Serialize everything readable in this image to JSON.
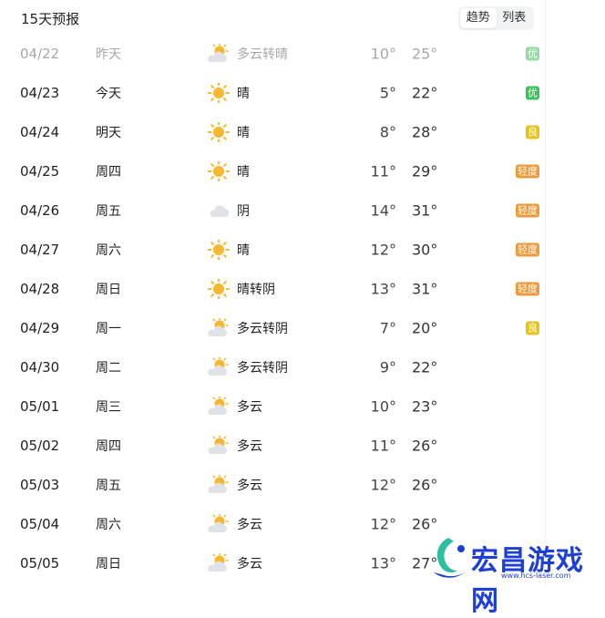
{
  "header": {
    "title": "15天预报"
  },
  "toggle": {
    "trend_label": "趋势",
    "list_label": "列表"
  },
  "days": [
    {
      "date": "04/22",
      "day": "昨天",
      "icon": "partly-cloudy-icon",
      "cond": "多云转晴",
      "low": "10°",
      "high": "25°",
      "aqi": "优",
      "aqi_level": "you",
      "past": true
    },
    {
      "date": "04/23",
      "day": "今天",
      "icon": "sun-icon",
      "cond": "晴",
      "low": "5°",
      "high": "22°",
      "aqi": "优",
      "aqi_level": "you"
    },
    {
      "date": "04/24",
      "day": "明天",
      "icon": "sun-icon",
      "cond": "晴",
      "low": "8°",
      "high": "28°",
      "aqi": "良",
      "aqi_level": "liang"
    },
    {
      "date": "04/25",
      "day": "周四",
      "icon": "sun-icon",
      "cond": "晴",
      "low": "11°",
      "high": "29°",
      "aqi": "轻度",
      "aqi_level": "qingdu"
    },
    {
      "date": "04/26",
      "day": "周五",
      "icon": "cloud-icon",
      "cond": "阴",
      "low": "14°",
      "high": "31°",
      "aqi": "轻度",
      "aqi_level": "qingdu"
    },
    {
      "date": "04/27",
      "day": "周六",
      "icon": "sun-icon",
      "cond": "晴",
      "low": "12°",
      "high": "30°",
      "aqi": "轻度",
      "aqi_level": "qingdu"
    },
    {
      "date": "04/28",
      "day": "周日",
      "icon": "sun-icon",
      "cond": "晴转阴",
      "low": "13°",
      "high": "31°",
      "aqi": "轻度",
      "aqi_level": "qingdu"
    },
    {
      "date": "04/29",
      "day": "周一",
      "icon": "partly-cloudy-icon",
      "cond": "多云转阴",
      "low": "7°",
      "high": "20°",
      "aqi": "良",
      "aqi_level": "liang"
    },
    {
      "date": "04/30",
      "day": "周二",
      "icon": "partly-cloudy-icon",
      "cond": "多云转阴",
      "low": "9°",
      "high": "22°",
      "aqi": "",
      "aqi_level": ""
    },
    {
      "date": "05/01",
      "day": "周三",
      "icon": "partly-cloudy-icon",
      "cond": "多云",
      "low": "10°",
      "high": "23°",
      "aqi": "",
      "aqi_level": ""
    },
    {
      "date": "05/02",
      "day": "周四",
      "icon": "partly-cloudy-icon",
      "cond": "多云",
      "low": "11°",
      "high": "26°",
      "aqi": "",
      "aqi_level": ""
    },
    {
      "date": "05/03",
      "day": "周五",
      "icon": "partly-cloudy-icon",
      "cond": "多云",
      "low": "12°",
      "high": "26°",
      "aqi": "",
      "aqi_level": ""
    },
    {
      "date": "05/04",
      "day": "周六",
      "icon": "partly-cloudy-icon",
      "cond": "多云",
      "low": "12°",
      "high": "26°",
      "aqi": "",
      "aqi_level": ""
    },
    {
      "date": "05/05",
      "day": "周日",
      "icon": "partly-cloudy-icon",
      "cond": "多云",
      "low": "13°",
      "high": "27°",
      "aqi": "",
      "aqi_level": ""
    }
  ],
  "colors": {
    "aqi_you": "#3fbf5b",
    "aqi_liang": "#e9c21d",
    "aqi_qingdu": "#ef9a3a",
    "sun": "#f7b731",
    "cloud": "#dfe3e8"
  },
  "watermark": {
    "title": "宏昌游戏网",
    "url": "www.hcs-laser.com"
  }
}
